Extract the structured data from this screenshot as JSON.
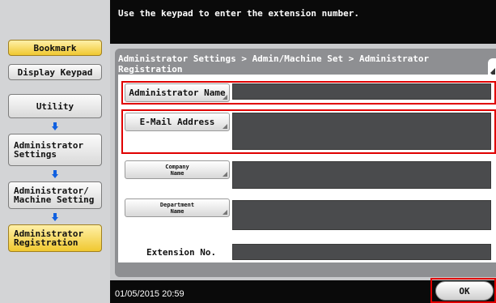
{
  "message": "Use the keypad to enter the extension number.",
  "left_panel": {
    "bookmark": "Bookmark",
    "display_keypad": "Display Keypad",
    "nav": [
      "Utility",
      "Administrator\nSettings",
      "Administrator/\nMachine Setting",
      "Administrator\nRegistration"
    ]
  },
  "breadcrumb": "Administrator Settings > Admin/Machine Set > Administrator Registration",
  "fields": {
    "admin_name": "Administrator Name",
    "email": "E-Mail Address",
    "company": "Company\nName",
    "department": "Department\nName",
    "extension": "Extension No."
  },
  "footer": {
    "datetime": "01/05/2015  20:59",
    "ok": "OK"
  },
  "colors": {
    "highlight": "#e00000",
    "current_nav": "#f0c830"
  }
}
